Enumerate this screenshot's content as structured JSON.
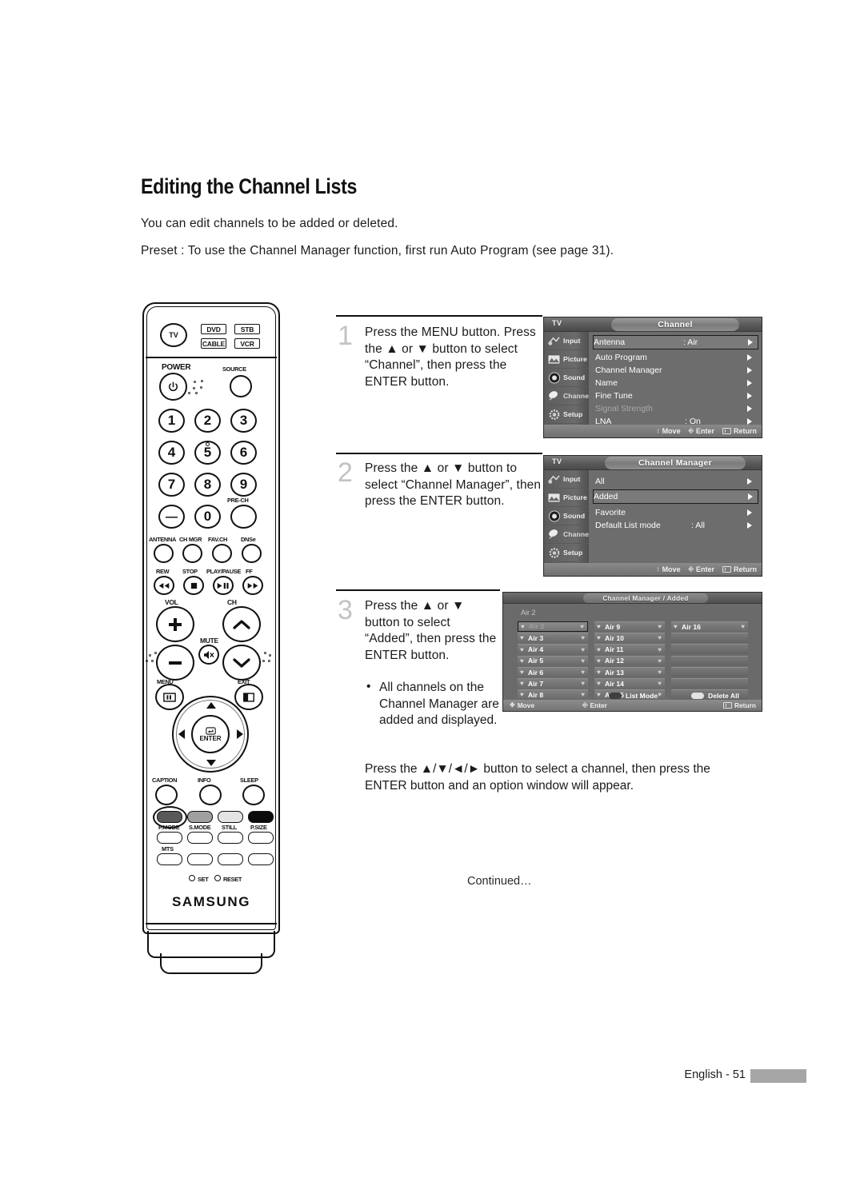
{
  "page": {
    "title": "Editing the Channel Lists",
    "intro_1": "You can edit channels to be added or deleted.",
    "intro_2": "Preset : To use the Channel Manager function, first run Auto Program (see page 31).",
    "closing": "Press the ▲/▼/◄/► button to select a channel, then press the ENTER button and an option window will appear.",
    "continued": "Continued…",
    "footer": "English - 51"
  },
  "steps": [
    {
      "number": "1",
      "text": "Press the MENU button.\nPress the ▲ or ▼ button to select “Channel”, then press the ENTER button."
    },
    {
      "number": "2",
      "text": "Press the ▲ or ▼ button to select “Channel Manager”, then press the ENTER button."
    },
    {
      "number": "3",
      "text": "Press the ▲ or ▼ button to select “Added”, then press the ENTER button.",
      "bullet": "All channels on the Channel Manager are added and displayed.",
      "bullet_mark": "•"
    }
  ],
  "osd_common": {
    "tv_label": "TV",
    "sidebar": [
      {
        "label": "Input",
        "icon": "input-icon"
      },
      {
        "label": "Picture",
        "icon": "picture-icon"
      },
      {
        "label": "Sound",
        "icon": "sound-icon"
      },
      {
        "label": "Channel",
        "icon": "channel-icon"
      },
      {
        "label": "Setup",
        "icon": "setup-icon"
      }
    ],
    "hints": {
      "move": "Move",
      "enter": "Enter",
      "return": "Return"
    }
  },
  "osd_channel": {
    "title": "Channel",
    "rows": [
      {
        "label": "Antenna",
        "value": ": Air",
        "selected": true,
        "dim": false
      },
      {
        "label": "Auto Program",
        "value": "",
        "selected": false,
        "dim": false
      },
      {
        "label": "Channel Manager",
        "value": "",
        "selected": false,
        "dim": false
      },
      {
        "label": "Name",
        "value": "",
        "selected": false,
        "dim": false
      },
      {
        "label": "Fine Tune",
        "value": "",
        "selected": false,
        "dim": false
      },
      {
        "label": "Signal Strength",
        "value": "",
        "selected": false,
        "dim": true
      },
      {
        "label": "LNA",
        "value": ": On",
        "selected": false,
        "dim": false
      }
    ]
  },
  "osd_channel_manager": {
    "title": "Channel Manager",
    "rows": [
      {
        "label": "All",
        "value": "",
        "selected": false,
        "dim": false
      },
      {
        "label": "Added",
        "value": "",
        "selected": true,
        "dim": false
      },
      {
        "label": "Favorite",
        "value": "",
        "selected": false,
        "dim": false
      },
      {
        "label": "Default List mode",
        "value": ": All",
        "selected": false,
        "dim": false
      }
    ]
  },
  "osd_added_list": {
    "title": "Channel Manager / Added",
    "current_channel": "Air 2",
    "columns": [
      [
        {
          "name": "Air 2",
          "selected": true
        },
        {
          "name": "Air 3",
          "selected": false
        },
        {
          "name": "Air 4",
          "selected": false
        },
        {
          "name": "Air 5",
          "selected": false
        },
        {
          "name": "Air 6",
          "selected": false
        },
        {
          "name": "Air 7",
          "selected": false
        },
        {
          "name": "Air 8",
          "selected": false
        }
      ],
      [
        {
          "name": "Air 9",
          "selected": false
        },
        {
          "name": "Air 10",
          "selected": false
        },
        {
          "name": "Air 11",
          "selected": false
        },
        {
          "name": "Air 12",
          "selected": false
        },
        {
          "name": "Air 13",
          "selected": false
        },
        {
          "name": "Air 14",
          "selected": false
        },
        {
          "name": "Air 15",
          "selected": false
        }
      ],
      [
        {
          "name": "Air 16",
          "selected": false
        },
        {
          "name": "",
          "selected": false
        },
        {
          "name": "",
          "selected": false
        },
        {
          "name": "",
          "selected": false
        },
        {
          "name": "",
          "selected": false
        },
        {
          "name": "",
          "selected": false
        },
        {
          "name": "",
          "selected": false
        }
      ]
    ],
    "legend": {
      "list_mode": "List Mode",
      "delete_all": "Delete All"
    },
    "hints": {
      "move": "Move",
      "enter": "Enter",
      "return": "Return"
    }
  },
  "remote": {
    "brand": "SAMSUNG",
    "device_buttons": [
      {
        "label": "TV",
        "shape": "round"
      },
      {
        "label": "DVD",
        "shape": "rect"
      },
      {
        "label": "STB",
        "shape": "rect"
      },
      {
        "label": "CABLE",
        "shape": "rect"
      },
      {
        "label": "VCR",
        "shape": "rect"
      }
    ],
    "power_label": "POWER",
    "source_label": "SOURCE",
    "numbers": [
      "1",
      "2",
      "3",
      "4",
      "5",
      "6",
      "7",
      "8",
      "9",
      "—",
      "0",
      ""
    ],
    "pre_ch_label": "PRE-CH",
    "function_row": [
      "ANTENNA",
      "CH MGR",
      "FAV.CH",
      "DNSe"
    ],
    "transport_row": [
      "REW",
      "STOP",
      "PLAY/PAUSE",
      "FF"
    ],
    "vol_label": "VOL",
    "ch_label": "CH",
    "mute_label": "MUTE",
    "menu_label": "MENU",
    "exit_label": "EXIT",
    "enter_label": "ENTER",
    "option_row": [
      "CAPTION",
      "INFO",
      "SLEEP"
    ],
    "mode_row": [
      "P.MODE",
      "S.MODE",
      "STILL",
      "P.SIZE"
    ],
    "mts_label": "MTS",
    "set_label": "SET",
    "reset_label": "RESET"
  }
}
